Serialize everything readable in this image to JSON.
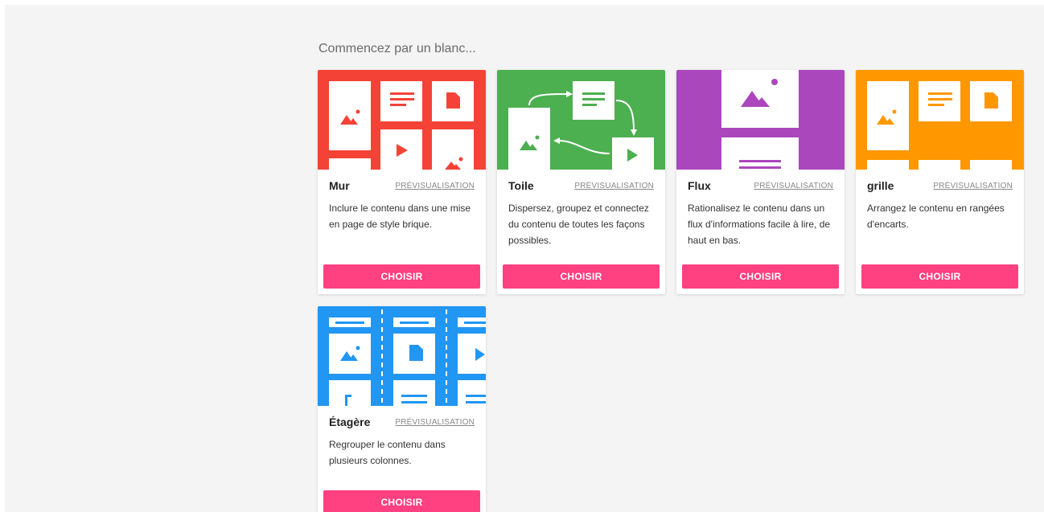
{
  "heading": "Commencez par un blanc...",
  "colors": {
    "wall": "#f44336",
    "canvas": "#4caf50",
    "stream": "#ab47bc",
    "grid": "#ff9800",
    "shelf": "#2196f3",
    "button": "#ff4081"
  },
  "cards": [
    {
      "title": "Mur",
      "preview": "PRÉVISUALISATION",
      "description": "Inclure le contenu dans une mise en page de style brique.",
      "button": "CHOISIR"
    },
    {
      "title": "Toile",
      "preview": "PRÉVISUALISATION",
      "description": "Dispersez, groupez et connectez du contenu de toutes les façons possibles.",
      "button": "CHOISIR"
    },
    {
      "title": "Flux",
      "preview": "PRÉVISUALISATION",
      "description": "Rationalisez le contenu dans un flux d'informations facile à lire, de haut en bas.",
      "button": "CHOISIR"
    },
    {
      "title": "grille",
      "preview": "PRÉVISUALISATION",
      "description": "Arrangez le contenu en rangées d'encarts.",
      "button": "CHOISIR"
    },
    {
      "title": "Étagère",
      "preview": "PRÉVISUALISATION",
      "description": "Regrouper le contenu dans plusieurs colonnes.",
      "button": "CHOISIR"
    }
  ]
}
